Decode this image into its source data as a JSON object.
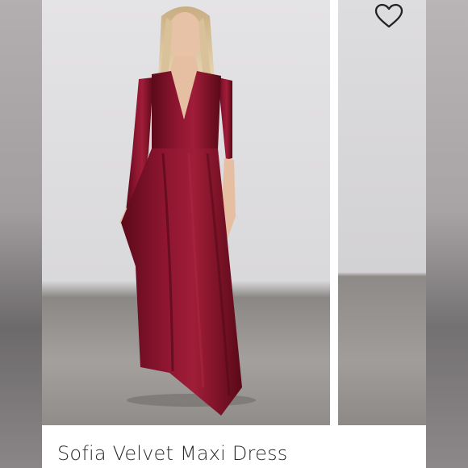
{
  "listing": {
    "title": "Sofia Velvet Maxi Dress"
  },
  "images": {
    "main": "product-photo-woman-burgundy-velvet-maxi-dress",
    "next": "product-photo-secondary"
  },
  "icons": {
    "like": "heart-outline-icon"
  },
  "colors": {
    "dress": "#7a0f24",
    "background": "#ffffff",
    "title_text": "#2b2b2b"
  }
}
